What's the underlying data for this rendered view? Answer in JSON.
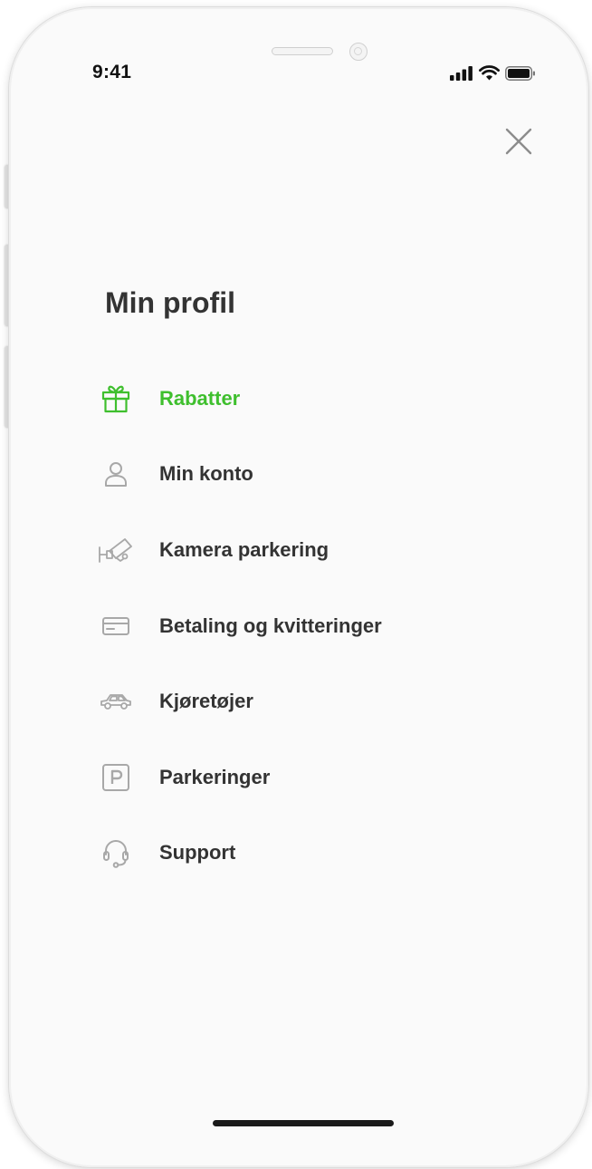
{
  "status_bar": {
    "time": "9:41"
  },
  "header": {
    "close_icon": "close-icon"
  },
  "page": {
    "title": "Min profil"
  },
  "menu": {
    "items": [
      {
        "label": "Rabatter",
        "icon": "gift-icon",
        "active": true
      },
      {
        "label": "Min konto",
        "icon": "user-icon",
        "active": false
      },
      {
        "label": "Kamera parkering",
        "icon": "camera-icon",
        "active": false
      },
      {
        "label": "Betaling og kvitteringer",
        "icon": "card-icon",
        "active": false
      },
      {
        "label": "Kjøretøjer",
        "icon": "car-icon",
        "active": false
      },
      {
        "label": "Parkeringer",
        "icon": "parking-icon",
        "active": false
      },
      {
        "label": "Support",
        "icon": "headset-icon",
        "active": false
      }
    ]
  },
  "colors": {
    "accent": "#3fbf2e",
    "text": "#333333",
    "icon": "#a8a8a8",
    "background": "#fafafa"
  }
}
